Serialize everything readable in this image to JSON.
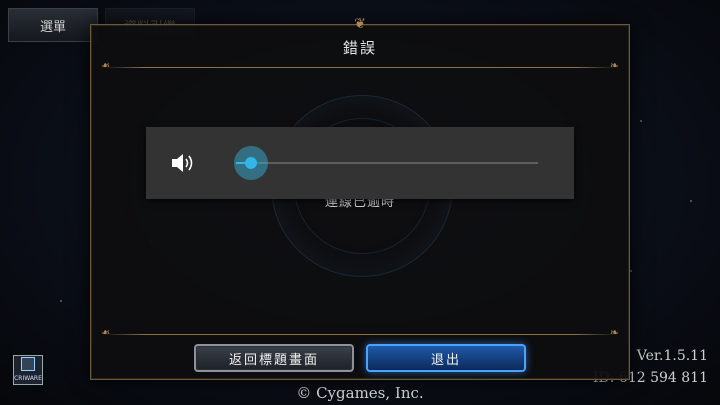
{
  "top_tabs": {
    "menu_label": "選單",
    "second_label": "資料引繼"
  },
  "dialog": {
    "title": "錯誤",
    "message": "連線已逾時",
    "buttons": {
      "return_title": "返回標題畫面",
      "exit": "退出"
    }
  },
  "volume_overlay": {
    "icon": "speaker-icon",
    "level_fraction": 0.05,
    "accent_color": "#33b5e5"
  },
  "footer": {
    "version": "Ver.1.5.11",
    "user_id": "ID: 612 594 811",
    "copyright": "© Cygames, Inc.",
    "logo_text": "CRIWARE"
  },
  "colors": {
    "dialog_border": "#6b5a3a",
    "exit_button": "#1f5aa8"
  }
}
